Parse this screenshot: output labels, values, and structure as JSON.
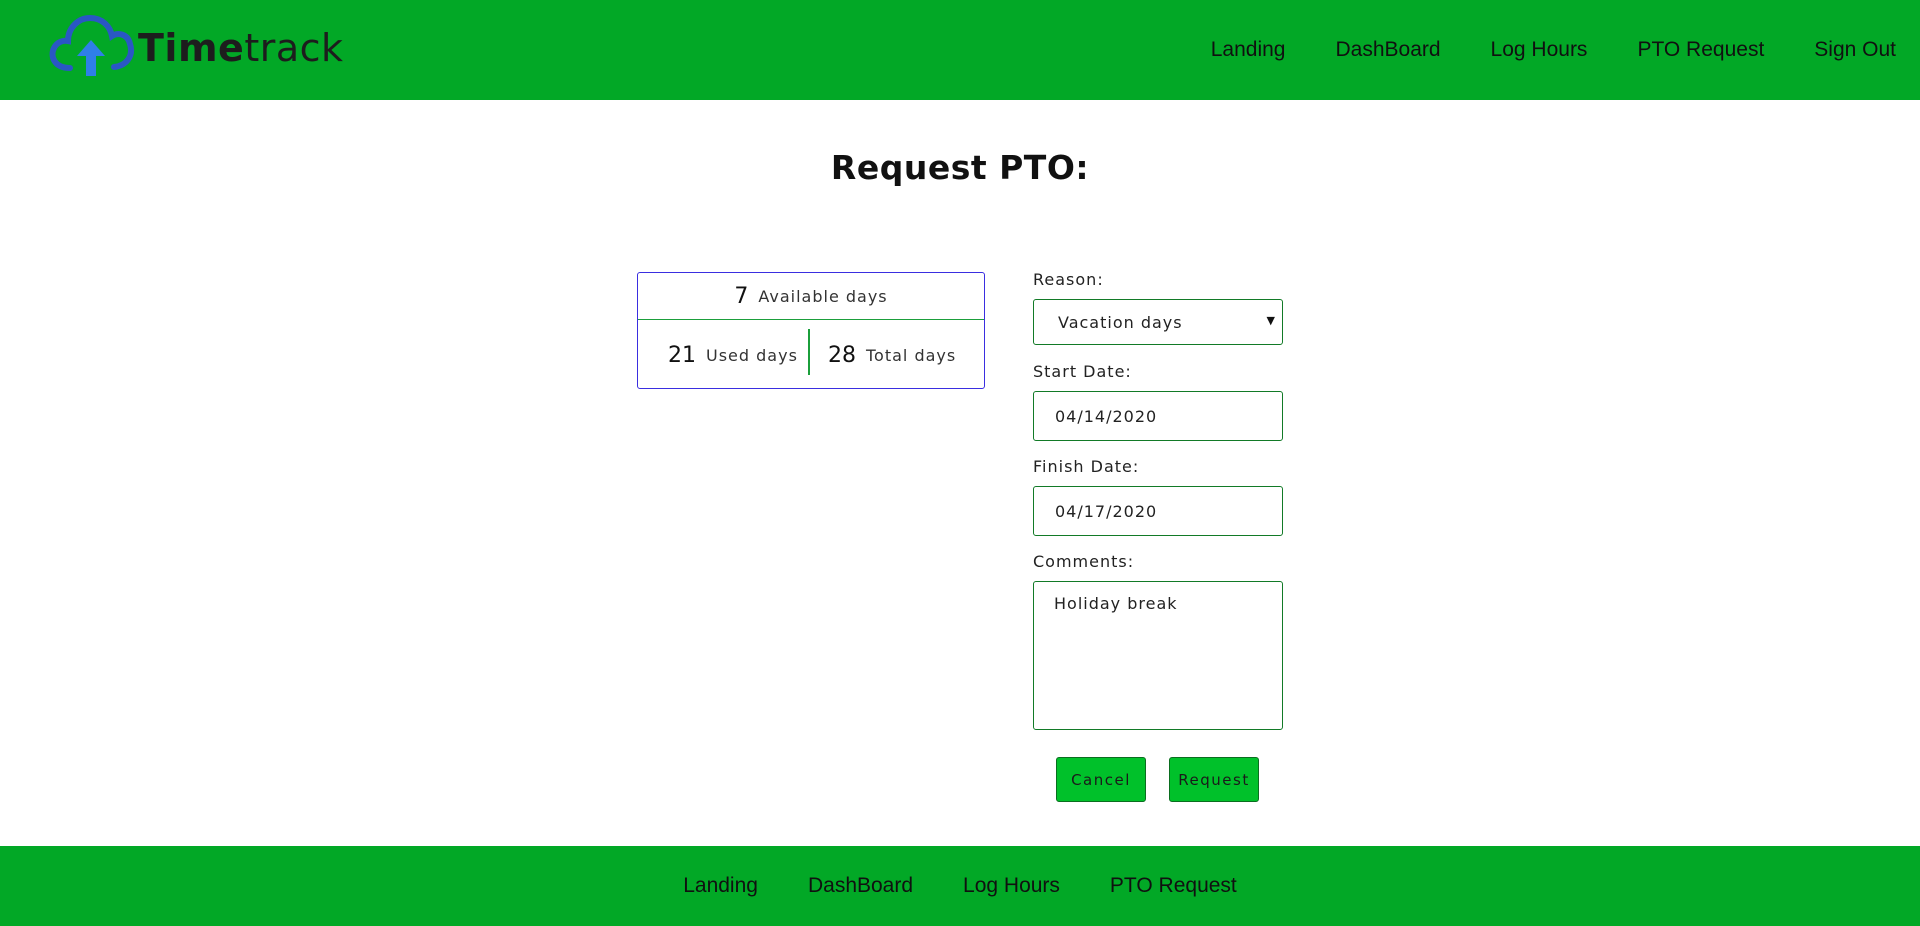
{
  "app": {
    "brand_bold": "Time",
    "brand_light": "track",
    "colors": {
      "header_bg": "#02a826",
      "button_bg": "#00c12a",
      "stats_border": "#3a2ee0",
      "divider": "#1b9f3b"
    },
    "logo_icon": "cloud-upload-icon"
  },
  "header": {
    "nav": [
      "Landing",
      "DashBoard",
      "Log Hours",
      "PTO Request",
      "Sign Out"
    ]
  },
  "page": {
    "title": "Request PTO:"
  },
  "stats": {
    "available": {
      "value": "7",
      "label": "Available days"
    },
    "used": {
      "value": "21",
      "label": "Used days"
    },
    "total": {
      "value": "28",
      "label": "Total days"
    }
  },
  "form": {
    "reason": {
      "label": "Reason:",
      "value": "Vacation days"
    },
    "start_date": {
      "label": "Start Date:",
      "value": "04/14/2020"
    },
    "finish_date": {
      "label": "Finish Date:",
      "value": "04/17/2020"
    },
    "comments": {
      "label": "Comments:",
      "value": "Holiday break"
    },
    "cancel_label": "Cancel",
    "request_label": "Request"
  },
  "footer": {
    "nav": [
      "Landing",
      "DashBoard",
      "Log Hours",
      "PTO Request"
    ]
  }
}
